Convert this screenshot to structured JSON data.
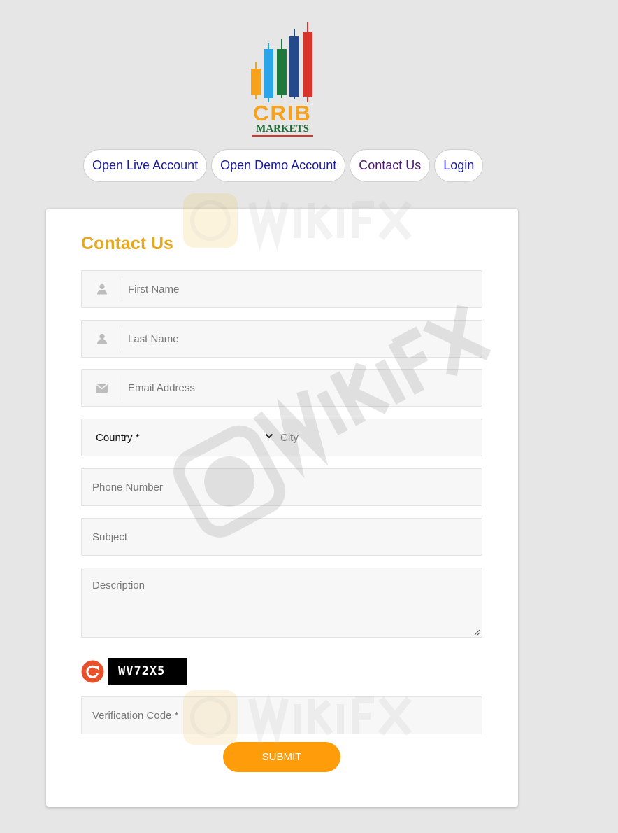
{
  "brand": {
    "name_line1": "CRIB",
    "name_line2": "MARKETS",
    "colors": {
      "orange": "#f6a21c",
      "green": "#1e6b34",
      "red": "#d9342b",
      "blue": "#2aa6e8",
      "navy": "#244a8c"
    }
  },
  "nav": {
    "items": [
      {
        "label": "Open Live Account"
      },
      {
        "label": "Open Demo Account"
      },
      {
        "label": "Contact Us"
      },
      {
        "label": "Login"
      }
    ]
  },
  "form": {
    "title": "Contact Us",
    "first_name": {
      "placeholder": "First Name",
      "icon": "user-icon"
    },
    "last_name": {
      "placeholder": "Last Name",
      "icon": "user-icon"
    },
    "email": {
      "placeholder": "Email Address",
      "icon": "envelope-icon"
    },
    "country": {
      "selected": "Country *"
    },
    "city": {
      "placeholder": "City"
    },
    "phone": {
      "placeholder": "Phone Number"
    },
    "subject": {
      "placeholder": "Subject"
    },
    "description": {
      "placeholder": "Description"
    },
    "captcha": {
      "code": "WV72X5"
    },
    "verification": {
      "placeholder": "Verification Code *"
    },
    "submit_label": "SUBMIT",
    "colors": {
      "title": "#e5a823",
      "submit": "#ff9c09",
      "nav_text": "#1a1aa0"
    }
  }
}
